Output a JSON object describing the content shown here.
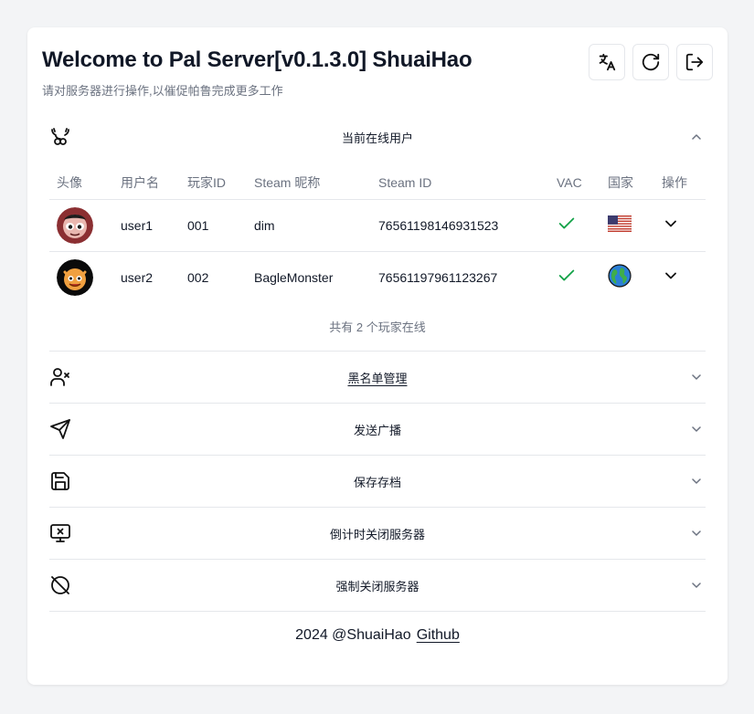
{
  "header": {
    "title": "Welcome to Pal Server[v0.1.3.0] ShuaiHao",
    "subtitle": "请对服务器进行操作,以催促帕鲁完成更多工作",
    "buttons": [
      {
        "icon": "translate-icon"
      },
      {
        "icon": "refresh-icon"
      },
      {
        "icon": "logout-icon"
      }
    ]
  },
  "online": {
    "title": "当前在线用户",
    "columns": [
      "头像",
      "用户名",
      "玩家ID",
      "Steam 昵称",
      "Steam ID",
      "VAC",
      "国家",
      "操作"
    ],
    "rows": [
      {
        "username": "user1",
        "player_id": "001",
        "nickname": "dim",
        "steam_id": "76561198146931523",
        "vac": "check",
        "country": "us-flag"
      },
      {
        "username": "user2",
        "player_id": "002",
        "nickname": "BagleMonster",
        "steam_id": "76561197961123267",
        "vac": "check",
        "country": "globe"
      }
    ],
    "summary": "共有 2 个玩家在线"
  },
  "sections": [
    {
      "title": "黑名单管理",
      "icon": "user-x-icon"
    },
    {
      "title": "发送广播",
      "icon": "send-icon"
    },
    {
      "title": "保存存档",
      "icon": "save-icon"
    },
    {
      "title": "倒计时关闭服务器",
      "icon": "monitor-x-icon"
    },
    {
      "title": "强制关闭服务器",
      "icon": "power-off-icon"
    }
  ],
  "footer": {
    "text": "2024 @ShuaiHao",
    "link": "Github"
  },
  "colors": {
    "background": "#f3f4f6",
    "card": "#ffffff",
    "muted": "#6b7280",
    "border": "#e5e7eb",
    "check": "#16a34a"
  }
}
